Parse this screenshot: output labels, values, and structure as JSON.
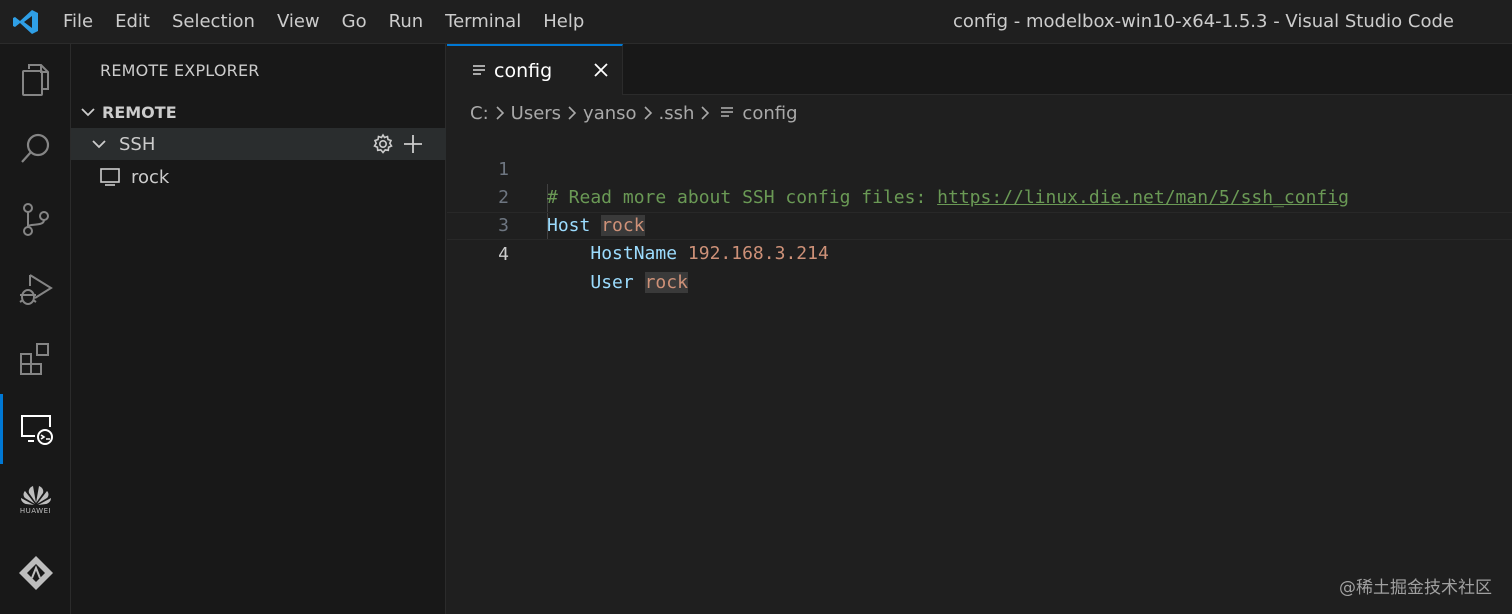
{
  "titlebar": {
    "menu": [
      "File",
      "Edit",
      "Selection",
      "View",
      "Go",
      "Run",
      "Terminal",
      "Help"
    ],
    "window_title": "config - modelbox-win10-x64-1.5.3 - Visual Studio Code"
  },
  "activity_bar": {
    "items": [
      "explorer-icon",
      "search-icon",
      "source-control-icon",
      "run-debug-icon",
      "extensions-icon",
      "remote-explorer-icon",
      "huawei-icon",
      "modelarts-icon"
    ],
    "active": "remote-explorer-icon",
    "huawei_text": "HUAWEI"
  },
  "sidebar": {
    "title": "REMOTE EXPLORER",
    "section": "REMOTE",
    "group": "SSH",
    "hosts": [
      "rock"
    ]
  },
  "editor": {
    "tab": {
      "label": "config"
    },
    "breadcrumb": [
      "C:",
      "Users",
      "yanso",
      ".ssh",
      "config"
    ],
    "lines": [
      {
        "num": "1",
        "comment": "# Read more about SSH config files: ",
        "link": "https://linux.die.net/man/5/ssh_config"
      },
      {
        "num": "2",
        "key": "Host",
        "value": "rock"
      },
      {
        "num": "3",
        "indent": "    ",
        "key": "HostName",
        "value": "192.168.3.214"
      },
      {
        "num": "4",
        "indent": "    ",
        "key": "User",
        "value": "rock"
      }
    ],
    "active_line": "4"
  },
  "watermark": "@稀土掘金技术社区",
  "colors": {
    "accent": "#0078d4",
    "background": "#1f1f1f",
    "sidebar": "#181818"
  }
}
